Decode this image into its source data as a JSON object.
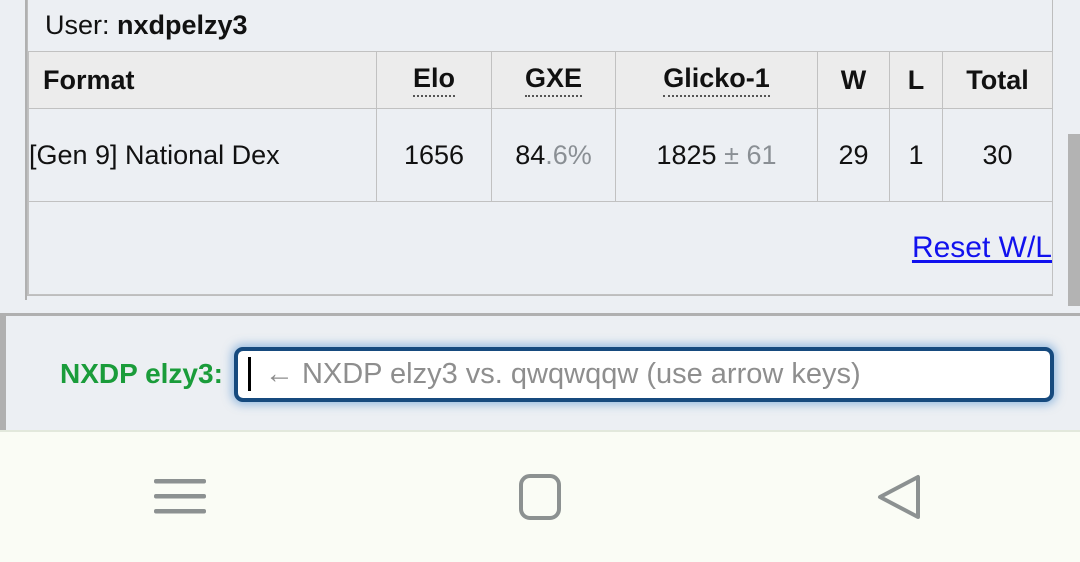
{
  "user_panel": {
    "user_label": "User:",
    "username": "nxdpelzy3"
  },
  "ladder_table": {
    "headers": {
      "format": "Format",
      "elo": "Elo",
      "gxe": "GXE",
      "glicko": "Glicko-1",
      "w": "W",
      "l": "L",
      "total": "Total"
    },
    "rows": [
      {
        "format": "[Gen 9] National Dex",
        "elo": "1656",
        "gxe_whole": "84",
        "gxe_fraction": ".6%",
        "glicko_rating": "1825",
        "glicko_pm": "±",
        "glicko_deviation": "61",
        "w": "29",
        "l": "1",
        "total": "30"
      }
    ],
    "reset_link": "Reset W/L"
  },
  "chat_bar": {
    "username": "NXDP elzy3:",
    "username_color": "#1a9c3a",
    "input_value": "",
    "input_placeholder": "← NXDP elzy3 vs. qwqwqqw (use arrow keys)"
  },
  "navbar": {
    "recents_icon": "hamburger-menu-icon",
    "home_icon": "rounded-square-home-icon",
    "back_icon": "triangle-back-icon"
  }
}
